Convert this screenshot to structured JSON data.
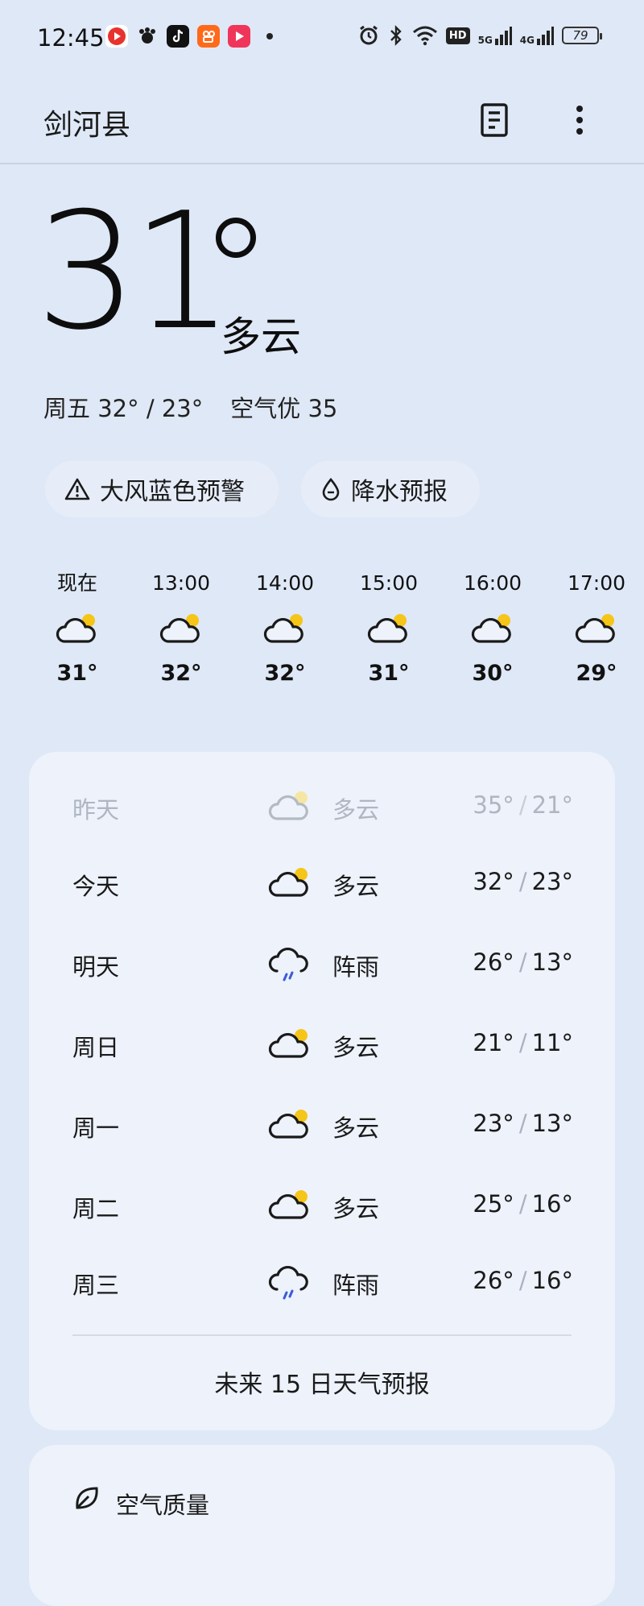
{
  "status_bar": {
    "time": "12:45",
    "battery": "79",
    "hd_label": "HD",
    "net_5g": "5G",
    "net_4g": "4G"
  },
  "header": {
    "city": "剑河县"
  },
  "current": {
    "temp": "31",
    "condition": "多云",
    "day_range": "周五 32° / 23°",
    "air": "空气优 35"
  },
  "alerts": {
    "wind": "大风蓝色预警",
    "rain": "降水预报"
  },
  "hourly": [
    {
      "time": "现在",
      "temp": "31°"
    },
    {
      "time": "13:00",
      "temp": "32°"
    },
    {
      "time": "14:00",
      "temp": "32°"
    },
    {
      "time": "15:00",
      "temp": "31°"
    },
    {
      "time": "16:00",
      "temp": "30°"
    },
    {
      "time": "17:00",
      "temp": "29°"
    }
  ],
  "daily": [
    {
      "day": "昨天",
      "icon": "cloudy-sun-icon",
      "cond": "多云",
      "high": "35°",
      "low": "21°"
    },
    {
      "day": "今天",
      "icon": "cloudy-sun-icon",
      "cond": "多云",
      "high": "32°",
      "low": "23°"
    },
    {
      "day": "明天",
      "icon": "rain-cloud-icon",
      "cond": "阵雨",
      "high": "26°",
      "low": "13°"
    },
    {
      "day": "周日",
      "icon": "cloudy-sun-icon",
      "cond": "多云",
      "high": "21°",
      "low": "11°"
    },
    {
      "day": "周一",
      "icon": "cloudy-sun-icon",
      "cond": "多云",
      "high": "23°",
      "low": "13°"
    },
    {
      "day": "周二",
      "icon": "cloudy-sun-icon",
      "cond": "多云",
      "high": "25°",
      "low": "16°"
    },
    {
      "day": "周三",
      "icon": "rain-cloud-icon",
      "cond": "阵雨",
      "high": "26°",
      "low": "16°"
    }
  ],
  "forecast_link": "未来 15 日天气预报",
  "air_quality": {
    "title": "空气质量"
  },
  "colors": {
    "background": "#dfe8f6",
    "card": "#edf2fb",
    "sun": "#f5c518",
    "rain": "#3b5bdb"
  }
}
